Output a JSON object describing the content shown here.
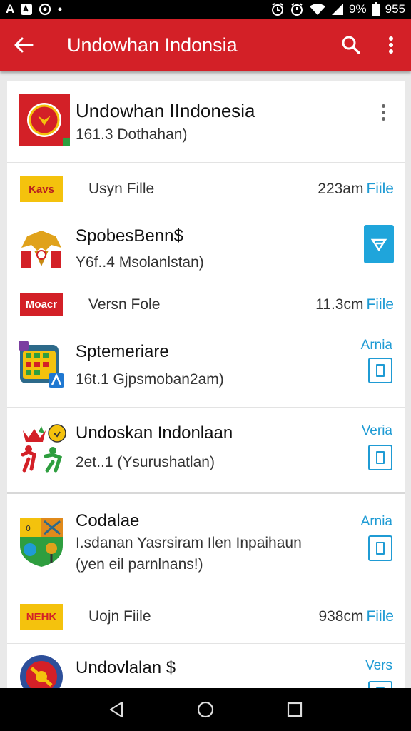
{
  "status_bar": {
    "left_glyphs": [
      "A"
    ],
    "battery_percent": "9%",
    "time": "955"
  },
  "app_bar": {
    "title": "Undowhan Indonsia"
  },
  "header_card": {
    "title": "Undowhan IIndonesia",
    "subtitle": "161.3 Dothahan)"
  },
  "rows": [
    {
      "kind": "file",
      "badge": "Kavs",
      "badge_bg": "#f4c20d",
      "badge_fg": "#b81f1f",
      "label": "Usyn Fille",
      "size": "223am",
      "link": "Fiile"
    },
    {
      "kind": "app",
      "title": "SpobesBenn$",
      "subtitle": "Y6f..4 Msolanlstan)"
    },
    {
      "kind": "file",
      "badge": "Moacr",
      "badge_bg": "#d32027",
      "badge_fg": "#ffffff",
      "label": "Versn Fole",
      "size": "11.3cm",
      "link": "Fiile"
    },
    {
      "kind": "app",
      "title": "Sptemeriare",
      "subtitle": "16t.1 Gjpsmoban2am)",
      "side_label": "Arnia"
    },
    {
      "kind": "app",
      "title": "Undoskan Indonlaan",
      "subtitle": "2et..1 (Ysurushatlan)",
      "side_label": "Veria"
    },
    {
      "kind": "app",
      "title": "Codalae",
      "subtitle": "I.sdanan Yasrsiram Ilen Inpaihaun",
      "subtitle2": "(yen eil parnlnans!)",
      "side_label": "Arnia"
    },
    {
      "kind": "file",
      "badge": "NEHK",
      "badge_bg": "#f4c20d",
      "badge_fg": "#d32027",
      "label": "Uojn Fiile",
      "size": "938cm",
      "link": "Fiile"
    },
    {
      "kind": "app",
      "title": "Undovlalan $",
      "side_label": "Vers"
    }
  ],
  "icons": {
    "back": "arrow-back-icon",
    "search": "search-icon",
    "more": "more-vert-icon",
    "nav_back": "triangle-back-icon",
    "nav_home": "circle-home-icon",
    "nav_recents": "square-recents-icon"
  },
  "colors": {
    "primary": "#d32027",
    "accent": "#1f9bd4"
  }
}
